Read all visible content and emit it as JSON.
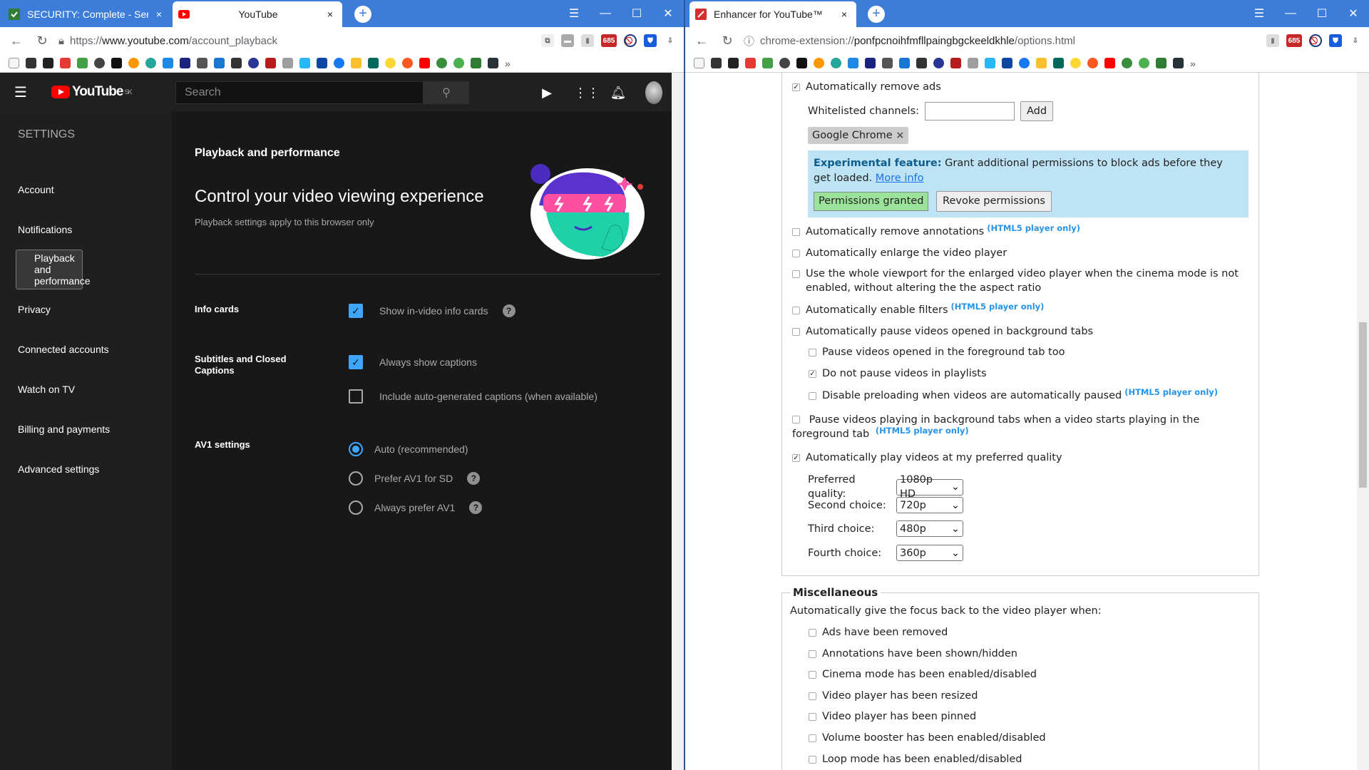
{
  "left_browser": {
    "tabs": [
      {
        "title": "SECURITY: Complete - Serio",
        "close": "×"
      },
      {
        "title": "YouTube",
        "close": "×"
      }
    ],
    "new_tab": "+",
    "window_controls": [
      "☰",
      "—",
      "☐",
      "✕"
    ],
    "url_scheme": "https://",
    "url_host": "www.youtube.com",
    "url_path": "/account_playback",
    "badge": "685"
  },
  "youtube": {
    "search_placeholder": "Search",
    "logo": "YouTube",
    "logo_region": "SK",
    "sidebar_heading": "SETTINGS",
    "sidebar_items": [
      "Account",
      "Notifications",
      "Playback and performance",
      "Privacy",
      "Connected accounts",
      "Watch on TV",
      "Billing and payments",
      "Advanced settings"
    ],
    "page_heading": "Playback and performance",
    "hero_title": "Control your video viewing experience",
    "hero_subtitle": "Playback settings apply to this browser only",
    "sections": {
      "info_cards": {
        "label": "Info cards",
        "option": "Show in-video info cards",
        "checked": true
      },
      "captions": {
        "label": "Subtitles and Closed Captions",
        "opt1": "Always show captions",
        "opt1_checked": true,
        "opt2": "Include auto-generated captions (when available)",
        "opt2_checked": false
      },
      "av1": {
        "label": "AV1 settings",
        "options": [
          "Auto (recommended)",
          "Prefer AV1 for SD",
          "Always prefer AV1"
        ],
        "selected": "Auto (recommended)"
      }
    },
    "help_glyph": "?"
  },
  "right_browser": {
    "tab_title": "Enhancer for YouTube™",
    "tab_close": "×",
    "new_tab": "+",
    "window_controls": [
      "☰",
      "—",
      "☐",
      "✕"
    ],
    "url_scheme": "chrome-extension://",
    "url_host": "ponfpcnoihfmfllpaingbgckeeldkhle",
    "url_path": "/options.html",
    "badge": "685"
  },
  "enhancer": {
    "remove_ads": "Automatically remove ads",
    "whitelist_label": "Whitelisted channels:",
    "add_button": "Add",
    "chip": "Google Chrome",
    "chip_x": "×",
    "exp_bold": "Experimental feature:",
    "exp_text": " Grant additional permissions to block ads before they get loaded. ",
    "exp_link": "More info",
    "perm_granted": "Permissions granted",
    "perm_revoke": "Revoke permissions",
    "html5": "(HTML5 player only)",
    "remove_annotations": "Automatically remove annotations",
    "enlarge": "Automatically enlarge the video player",
    "viewport": "Use the whole viewport for the enlarged video player when the cinema mode is not enabled, without altering the the aspect ratio",
    "filters": "Automatically enable filters",
    "pause_bg": "Automatically pause videos opened in background tabs",
    "pause_fg": "Pause videos opened in the foreground tab too",
    "no_pause_playlists": "Do not pause videos in playlists",
    "disable_preload": "Disable preloading when videos are automatically paused",
    "pause_playing": "Pause videos playing in background tabs when a video starts playing in the foreground tab",
    "auto_quality": "Automatically play videos at my preferred quality",
    "quality_rows": [
      {
        "label": "Preferred quality:",
        "value": "1080p HD"
      },
      {
        "label": "Second choice:",
        "value": "720p"
      },
      {
        "label": "Third choice:",
        "value": "480p"
      },
      {
        "label": "Fourth choice:",
        "value": "360p"
      }
    ],
    "misc_legend": "Miscellaneous",
    "misc_intro": "Automatically give the focus back to the video player when:",
    "misc_items": [
      "Ads have been removed",
      "Annotations have been shown/hidden",
      "Cinema mode has been enabled/disabled",
      "Video player has been resized",
      "Video player has been pinned",
      "Volume booster has been enabled/disabled",
      "Loop mode has been enabled/disabled"
    ],
    "checkmark": "✓"
  }
}
